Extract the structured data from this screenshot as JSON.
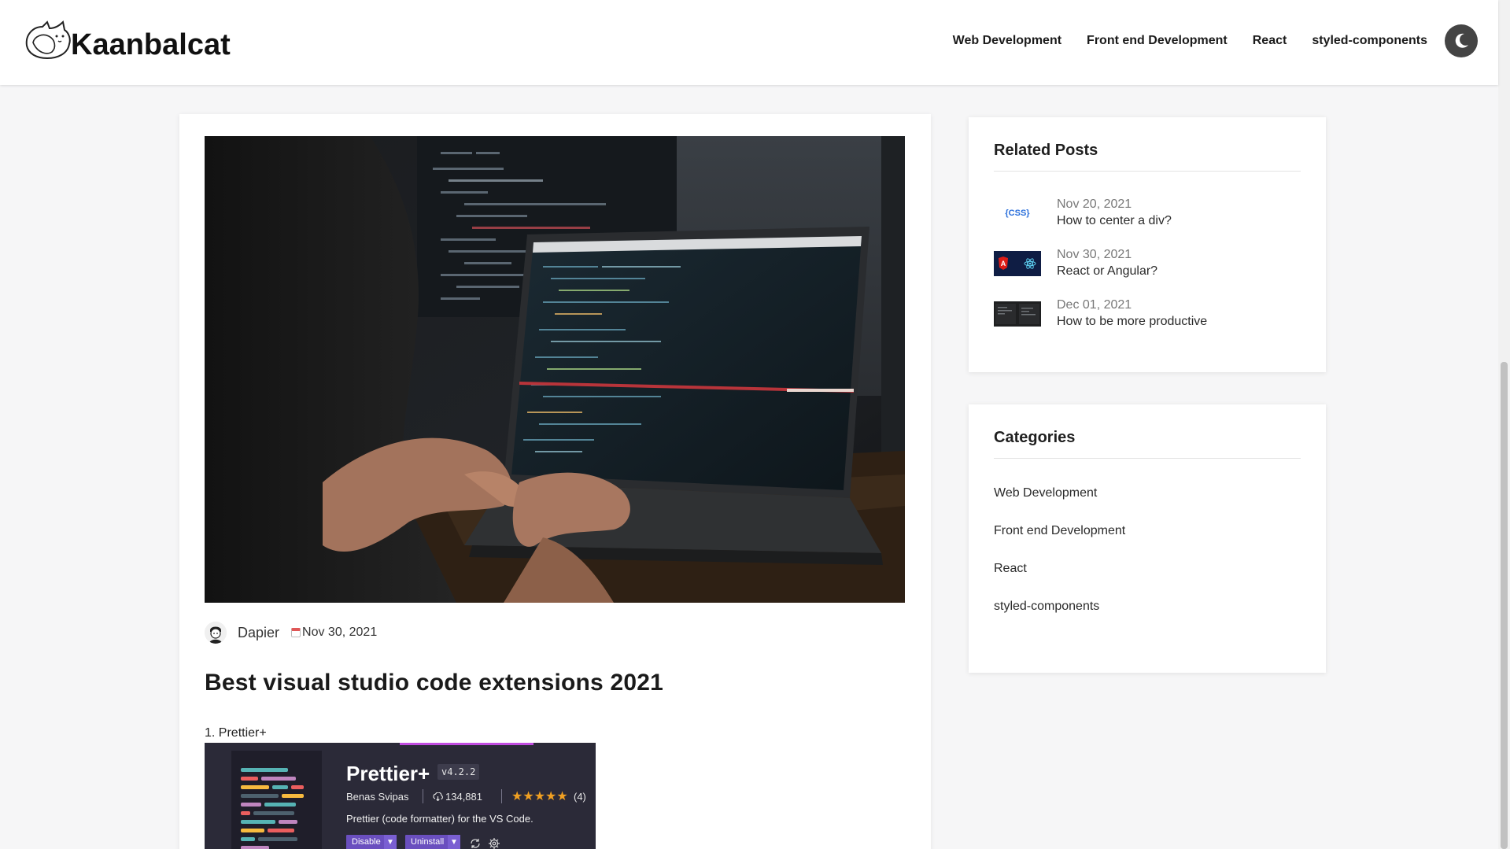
{
  "brand": {
    "name": "Kaanbalcat"
  },
  "nav": {
    "items": [
      {
        "label": "Web Development"
      },
      {
        "label": "Front end Development"
      },
      {
        "label": "React"
      },
      {
        "label": "styled-components"
      }
    ],
    "theme_toggle_icon": "moon-icon"
  },
  "post": {
    "author": "Dapier",
    "date": "Nov 30, 2021",
    "title": "Best visual studio code extensions 2021",
    "list_item": "1. Prettier+",
    "extension": {
      "name": "Prettier+",
      "version": "v4.2.2",
      "publisher": "Benas Svipas",
      "downloads": "134,881",
      "stars": "★★★★★",
      "rating_count": "(4)",
      "description": "Prettier (code formatter) for the VS Code.",
      "disable_label": "Disable",
      "uninstall_label": "Uninstall"
    }
  },
  "related": {
    "heading": "Related Posts",
    "items": [
      {
        "date": "Nov 20, 2021",
        "title": "How to center a div?",
        "thumb_label": "{CSS}"
      },
      {
        "date": "Nov 30, 2021",
        "title": "React or Angular?",
        "thumb_label": "A"
      },
      {
        "date": "Dec 01, 2021",
        "title": "How to be more productive"
      }
    ]
  },
  "categories": {
    "heading": "Categories",
    "items": [
      {
        "label": "Web Development"
      },
      {
        "label": "Front end Development"
      },
      {
        "label": "React"
      },
      {
        "label": "styled-components"
      }
    ]
  },
  "colors": {
    "accent_dark": "#444444",
    "card_bg": "#ffffff",
    "page_bg": "#f6f6f7",
    "extension_bg": "#2b2a38",
    "star": "#f0a022"
  }
}
